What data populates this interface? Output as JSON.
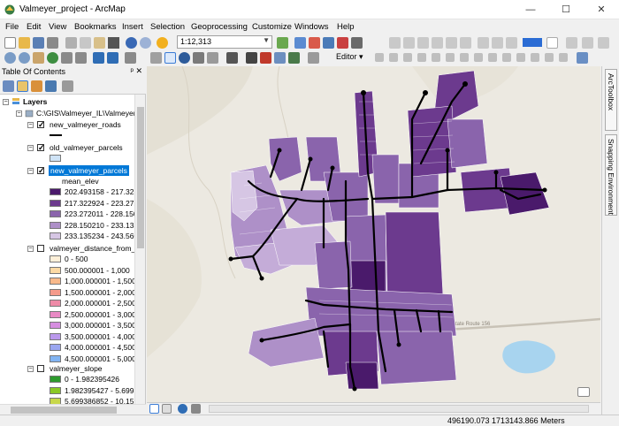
{
  "window": {
    "title": "Valmeyer_project - ArcMap",
    "minimize": "—",
    "maximize": "☐",
    "close": "✕"
  },
  "menu": [
    "File",
    "Edit",
    "View",
    "Bookmarks",
    "Insert",
    "Selection",
    "Geoprocessing",
    "Customize",
    "Windows",
    "Help"
  ],
  "toolbar": {
    "scale": "1:12,313",
    "editor_label": "Editor ▾"
  },
  "toc": {
    "title": "Table Of Contents",
    "pin": "ᵖ ✕",
    "layers_root": "Layers",
    "folder": "C:\\GIS\\Valmeyer_IL\\Valmeyer",
    "roads": "new_valmeyer_roads",
    "old_parcels": "old_valmeyer_parcels",
    "new_parcels": "new_valmeyer_parcels",
    "field": "mean_elev",
    "parcel_classes": [
      {
        "label": "202.493158 - 217.32292",
        "color": "#4a1a6b"
      },
      {
        "label": "217.322924 - 223.27201",
        "color": "#6c3a8e"
      },
      {
        "label": "223.272011 - 228.15020",
        "color": "#8a64ac"
      },
      {
        "label": "228.150210 - 233.13523",
        "color": "#ae90c8"
      },
      {
        "label": "233.135234 - 243.56030",
        "color": "#d6c6e4"
      }
    ],
    "distance_layer": "valmeyer_distance_from_",
    "distance_classes": [
      {
        "label": "0 - 500",
        "color": "#fef0d9"
      },
      {
        "label": "500.000001 - 1,000",
        "color": "#fcd9a4"
      },
      {
        "label": "1,000.000001 - 1,500",
        "color": "#f8b98b"
      },
      {
        "label": "1,500.000001 - 2,000",
        "color": "#f49a8a"
      },
      {
        "label": "2,000.000001 - 2,500",
        "color": "#ee8aa7"
      },
      {
        "label": "2,500.000001 - 3,000",
        "color": "#e889c4"
      },
      {
        "label": "3,000.000001 - 3,500",
        "color": "#d68ee0"
      },
      {
        "label": "3,500.000001 - 4,000",
        "color": "#ba98ec"
      },
      {
        "label": "4,000.000001 - 4,500",
        "color": "#9aa6f0"
      },
      {
        "label": "4,500.000001 - 5,000",
        "color": "#82b4f2"
      }
    ],
    "slope_layer": "valmeyer_slope",
    "slope_classes": [
      {
        "label": "0 - 1.982395426",
        "color": "#2e9b2e"
      },
      {
        "label": "1.982395427 - 5.699386",
        "color": "#8ac926"
      },
      {
        "label": "5.699386852 - 10.15977",
        "color": "#c8d84a"
      }
    ]
  },
  "dock": {
    "toolbox": "ArcToolbox",
    "snapping": "Snapping Environment"
  },
  "map": {
    "road_label": "State Route 156"
  },
  "status": {
    "coordinates": "496190.073  1713143.866 Meters"
  }
}
